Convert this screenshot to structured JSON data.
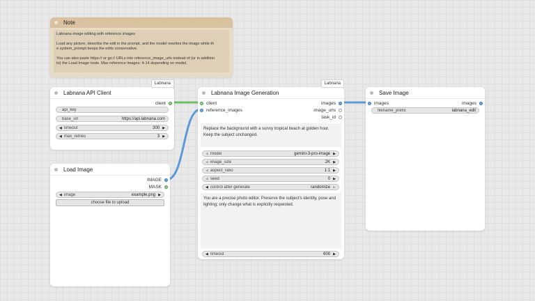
{
  "note": {
    "title": "Note",
    "lines": [
      "Labnana image editing with reference images",
      "Load any picture, describe the edit in the prompt, and the model rewrites the image while th",
      "e system_prompt keeps the edits conservative.",
      "You can also paste https:// or gs:// URLs into reference_image_urls instead of (or in addition",
      " to) the Load Image node. Max reference images: 4-14 depending on model."
    ]
  },
  "api_client": {
    "title": "Labnana API Client",
    "badge": "Labnana",
    "output_label": "client",
    "api_key_label": "api_key",
    "base_url_label": "base_url",
    "base_url_value": "https://api.labnana.com",
    "timeout_label": "timeout",
    "timeout_value": "300",
    "max_retries_label": "max_retries",
    "max_retries_value": "3"
  },
  "load_image": {
    "title": "Load Image",
    "output_image": "IMAGE",
    "output_mask": "MASK",
    "image_label": "image",
    "image_value": "example.png",
    "upload_label": "choose file to upload"
  },
  "generation": {
    "title": "Labnana Image Generation",
    "badge": "Labnana",
    "input_client": "client",
    "input_reference": "reference_images",
    "output_images": "images",
    "output_urls": "image_urls",
    "output_task": "task_id",
    "prompt": "Replace the background with a sunny tropical beach at golden hour. Keep the subject unchanged.",
    "model_label": "model",
    "model_value": "gemini-3-pro-image",
    "size_label": "image_size",
    "size_value": "2K",
    "ratio_label": "aspect_ratio",
    "ratio_value": "1:1",
    "seed_label": "seed",
    "seed_value": "0",
    "control_label": "control after generate",
    "control_value": "randomize",
    "system_prompt": "You are a precise photo editor. Preserve the subject's identity, pose and lighting; only change what is explicitly requested.",
    "timeout_label": "timeout",
    "timeout_value": "600"
  },
  "save_image": {
    "title": "Save Image",
    "input_images": "images",
    "output_images": "images",
    "prefix_label": "filename_prefix",
    "prefix_value": "labnana_edit"
  },
  "colors": {
    "client_link": "#6bbf65",
    "image_link": "#5b9ad8",
    "note_header": "#d8c2a0",
    "note_body": "#e8dcc4"
  }
}
